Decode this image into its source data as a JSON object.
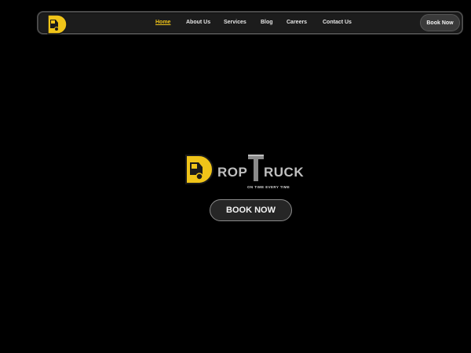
{
  "nav": {
    "logo_icon": "droptruck-logo-icon",
    "links": [
      {
        "label": "Home",
        "active": true
      },
      {
        "label": "About Us",
        "active": false
      },
      {
        "label": "Services",
        "active": false
      },
      {
        "label": "Blog",
        "active": false
      },
      {
        "label": "Careers",
        "active": false
      },
      {
        "label": "Contact Us",
        "active": false
      }
    ],
    "book_label": "Book Now"
  },
  "hero": {
    "brand_part1": "ROP",
    "brand_part2": "RUCK",
    "tagline": "ON TIME EVERY TIME",
    "book_label": "BOOK NOW"
  },
  "colors": {
    "accent": "#f0c419",
    "background": "#000000",
    "nav_bg": "#1c1c1c",
    "text_grey": "#bfbfbf"
  }
}
